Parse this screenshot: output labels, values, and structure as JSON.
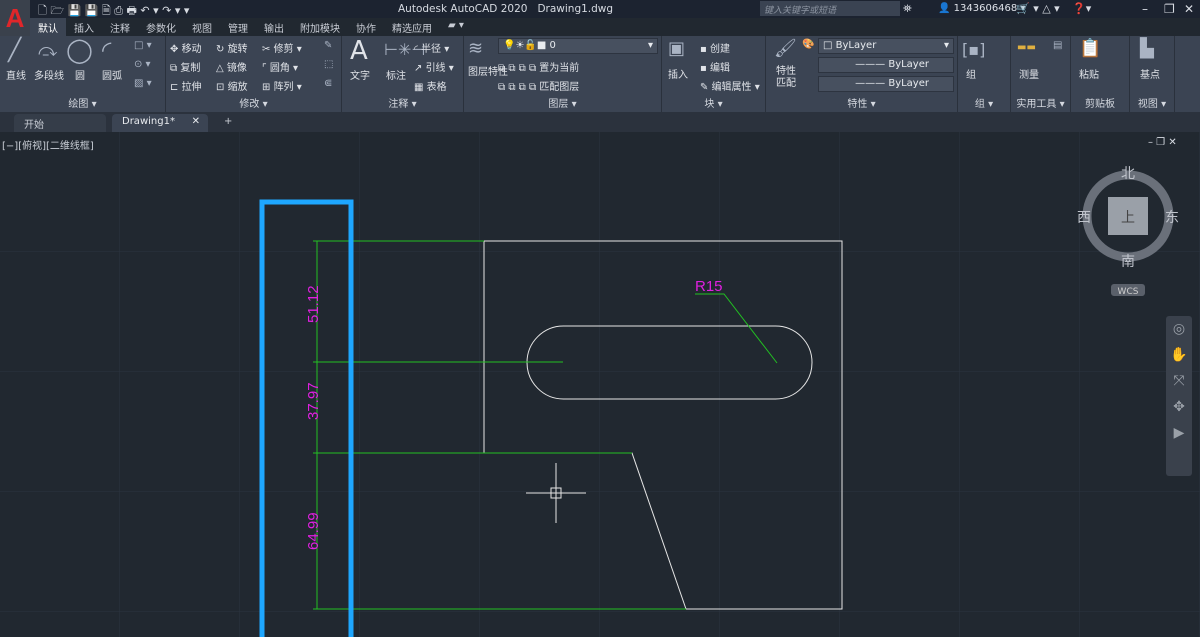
{
  "app": {
    "title": "Autodesk AutoCAD 2020",
    "filename": "Drawing1.dwg",
    "logo": "A"
  },
  "search": {
    "placeholder": "键入关键字或短语"
  },
  "user": {
    "name": "1343606468"
  },
  "ribbon_tabs": [
    "默认",
    "插入",
    "注释",
    "参数化",
    "视图",
    "管理",
    "输出",
    "附加模块",
    "协作",
    "精选应用"
  ],
  "panels": {
    "draw": {
      "label": "绘图",
      "items": [
        "直线",
        "多段线",
        "圆",
        "圆弧"
      ]
    },
    "modify": {
      "label": "修改",
      "items": [
        "移动",
        "旋转",
        "修剪",
        "复制",
        "镜像",
        "圆角",
        "拉伸",
        "缩放",
        "阵列"
      ]
    },
    "annotation": {
      "label": "注释",
      "items": [
        "文字",
        "标注",
        "半径",
        "引线",
        "表格"
      ]
    },
    "layers": {
      "label": "图层",
      "items": [
        "图层特性",
        "置为当前",
        "匹配图层"
      ],
      "current_layer": "0"
    },
    "block": {
      "label": "块",
      "items": [
        "插入",
        "创建",
        "编辑",
        "编辑属性"
      ]
    },
    "properties": {
      "label": "特性",
      "items": [
        "特性匹配"
      ],
      "color": "ByLayer",
      "linetype": "ByLayer",
      "lineweight": "ByLayer"
    },
    "group": {
      "label": "组",
      "items": [
        "组"
      ]
    },
    "utilities": {
      "label": "实用工具",
      "items": [
        "测量"
      ]
    },
    "clipboard": {
      "label": "剪贴板",
      "items": [
        "粘贴"
      ]
    },
    "view": {
      "label": "视图",
      "items": [
        "基点"
      ]
    }
  },
  "doc_tabs": [
    "开始",
    "Drawing1*"
  ],
  "viewport": {
    "label": "[−][俯视][二维线框]"
  },
  "viewcube": {
    "north": "北",
    "south": "南",
    "east": "东",
    "west": "西",
    "face": "上",
    "wcs": "WCS"
  },
  "dimensions": {
    "d1": "51.12",
    "d2": "37.97",
    "d3": "64.99",
    "radius": "R15"
  },
  "colors": {
    "background": "#212830",
    "dimension": "#22c022",
    "dim_text": "#e020e0",
    "geometry": "#e6e6e6",
    "highlight": "#1ea7ff"
  }
}
